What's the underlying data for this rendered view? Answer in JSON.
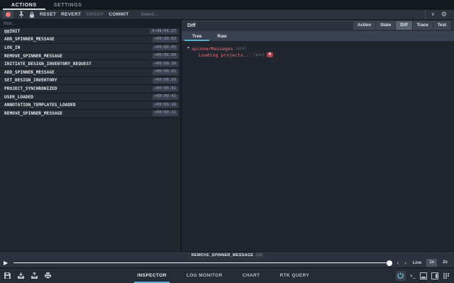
{
  "accent_colors": {
    "pink": "#e57a82",
    "cyan": "#57b0ce",
    "badge_red": "#a4454d"
  },
  "top_tabs": {
    "actions": "ACTIONS",
    "settings": "SETTINGS"
  },
  "toolbar": {
    "reset": "RESET",
    "revert": "REVERT",
    "sweep": "SWEEP",
    "commit": "COMMIT",
    "select_placeholder": "Select..."
  },
  "left_panel": {
    "filter_placeholder": "filter...",
    "actions": [
      {
        "name": "@@INIT",
        "time": "4:08:04.27"
      },
      {
        "name": "ADD_SPINNER_MESSAGE",
        "time": "+00:00.03"
      },
      {
        "name": "LOG_IN",
        "time": "+00:00.05"
      },
      {
        "name": "REMOVE_SPINNER_MESSAGE",
        "time": "+00:00.00"
      },
      {
        "name": "INITIATE_DESIGN_INVENTORY_REQUEST",
        "time": "+00:00.10"
      },
      {
        "name": "ADD_SPINNER_MESSAGE",
        "time": "+00:00.02"
      },
      {
        "name": "SET_DESIGN_INVENTORY",
        "time": "+00:00.39"
      },
      {
        "name": "PROJECT_SYNCHRONIZED",
        "time": "+00:00.81"
      },
      {
        "name": "USER_LOADED",
        "time": "+00:00.42"
      },
      {
        "name": "ANNOTATION_TEMPLATES_LOADED",
        "time": "+00:00.18"
      },
      {
        "name": "REMOVE_SPINNER_MESSAGE",
        "time": "+00:00.11"
      }
    ]
  },
  "right_panel": {
    "title": "Diff",
    "mode_buttons": [
      {
        "label": "Action"
      },
      {
        "label": "State"
      },
      {
        "label": "Diff"
      },
      {
        "label": "Trace"
      },
      {
        "label": "Test"
      }
    ],
    "view_tabs": [
      {
        "label": "Tree"
      },
      {
        "label": "Raw"
      }
    ],
    "tree": {
      "root_key": "spinnerMessages",
      "pin_label": "(pin)",
      "child_value": "Loading projects...",
      "child_badge": "0"
    }
  },
  "slider": {
    "current_action": "REMOVE_SPINNER_MESSAGE",
    "current_index": "(10)",
    "live": "Live",
    "speed_1x": "1x",
    "speed_2x": "2x"
  },
  "bottom_bar": {
    "tabs": [
      {
        "label": "INSPECTOR"
      },
      {
        "label": "LOG MONITOR"
      },
      {
        "label": "CHART"
      },
      {
        "label": "RTK QUERY"
      }
    ]
  },
  "glyphs": {
    "play": "▶",
    "prev": "‹",
    "next": "›",
    "dropdown_caret": "∨",
    "gear": "⚙",
    "terminal": ">_",
    "tree_arrow": "▼"
  }
}
